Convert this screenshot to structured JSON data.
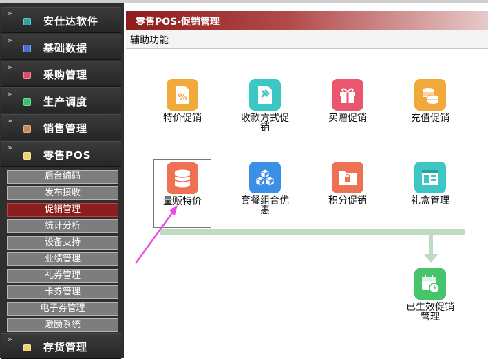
{
  "sidebar": {
    "items": [
      {
        "label": "安仕达软件",
        "icon": "software-icon",
        "color": "#2aa3a3"
      },
      {
        "label": "基础数据",
        "icon": "database-icon",
        "color": "#4a6fd6"
      },
      {
        "label": "采购管理",
        "icon": "purchase-icon",
        "color": "#e04d6a"
      },
      {
        "label": "生产调度",
        "icon": "production-icon",
        "color": "#33c36b"
      },
      {
        "label": "销售管理",
        "icon": "sales-icon",
        "color": "#c98a5a"
      },
      {
        "label": "零售POS",
        "icon": "pos-icon",
        "color": "#f3d36b"
      },
      {
        "label": "存货管理",
        "icon": "inventory-icon",
        "color": "#f3d36b"
      }
    ],
    "subitems": [
      "后台编码",
      "发布接收",
      "促销管理",
      "统计分析",
      "设备支持",
      "业绩管理",
      "礼券管理",
      "卡券管理",
      "电子券管理",
      "激励系统"
    ],
    "active_sub": "促销管理"
  },
  "main": {
    "title": "零售POS-促销管理",
    "aux": "辅助功能",
    "tiles": [
      {
        "label": "特价促销",
        "icon": "percent-icon",
        "color": "#f2a93b"
      },
      {
        "label": "收款方式促销",
        "icon": "pin-icon",
        "color": "#3cc7c4"
      },
      {
        "label": "买赠促销",
        "icon": "gift-icon",
        "color": "#e9566e"
      },
      {
        "label": "充值促销",
        "icon": "coins-icon",
        "color": "#f2a93b"
      },
      {
        "label": "量贩特价",
        "icon": "stack-icon",
        "color": "#ee7153"
      },
      {
        "label": "套餐组合优惠",
        "icon": "cubes-icon",
        "color": "#3b8fe6"
      },
      {
        "label": "积分促销",
        "icon": "folder-lock-icon",
        "color": "#ee7153"
      },
      {
        "label": "礼盒管理",
        "icon": "window-icon",
        "color": "#3cc7c4"
      },
      {
        "label": "已生效促销管理",
        "icon": "calendar-clock-icon",
        "color": "#45c46a"
      }
    ]
  },
  "colors": {
    "arrow": "#e94be6",
    "flow": "#bfdcc3",
    "active": "#8b1d1d"
  }
}
